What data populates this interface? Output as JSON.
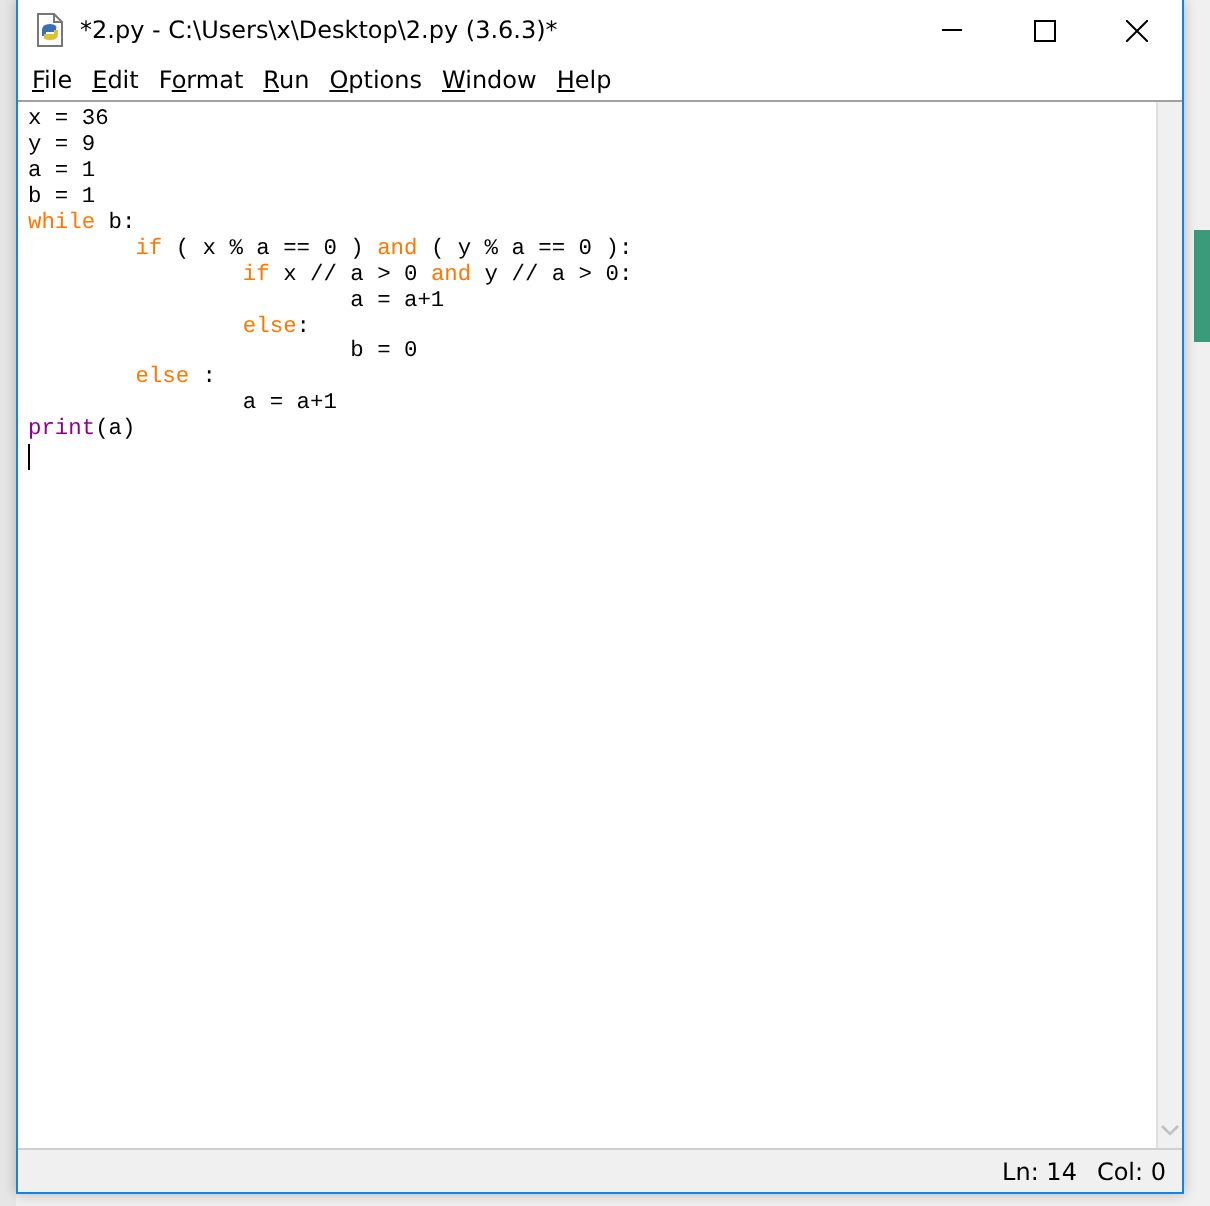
{
  "window": {
    "title": "*2.py - C:\\Users\\x\\Desktop\\2.py (3.6.3)*"
  },
  "menu": [
    {
      "key": "F",
      "after": "ile"
    },
    {
      "key": "E",
      "after": "dit"
    },
    {
      "before": "F",
      "key": "o",
      "after": "rmat"
    },
    {
      "key": "R",
      "after": "un"
    },
    {
      "key": "O",
      "after": "ptions"
    },
    {
      "key": "W",
      "after": "indow"
    },
    {
      "key": "H",
      "after": "elp"
    }
  ],
  "editor": {
    "lines": [
      {
        "tokens": [
          {
            "text": "x = 36",
            "kind": "plain"
          }
        ]
      },
      {
        "tokens": [
          {
            "text": "y = 9",
            "kind": "plain"
          }
        ]
      },
      {
        "tokens": [
          {
            "text": "a = 1",
            "kind": "plain"
          }
        ]
      },
      {
        "tokens": [
          {
            "text": "b = 1",
            "kind": "plain"
          }
        ]
      },
      {
        "tokens": [
          {
            "text": "while",
            "kind": "keyword"
          },
          {
            "text": " b:",
            "kind": "plain"
          }
        ]
      },
      {
        "tokens": [
          {
            "text": "\tif",
            "kind": "keyword"
          },
          {
            "text": " ( x % a == 0 ) ",
            "kind": "plain"
          },
          {
            "text": "and",
            "kind": "keyword"
          },
          {
            "text": " ( y % a == 0 ):",
            "kind": "plain"
          }
        ]
      },
      {
        "tokens": [
          {
            "text": "\t\tif",
            "kind": "keyword"
          },
          {
            "text": " x // a > 0 ",
            "kind": "plain"
          },
          {
            "text": "and",
            "kind": "keyword"
          },
          {
            "text": " y // a > 0:",
            "kind": "plain"
          }
        ]
      },
      {
        "tokens": [
          {
            "text": "\t\t\ta = a+1",
            "kind": "plain"
          }
        ]
      },
      {
        "tokens": [
          {
            "text": "\t\telse",
            "kind": "keyword"
          },
          {
            "text": ":",
            "kind": "plain"
          }
        ]
      },
      {
        "tokens": [
          {
            "text": "\t\t\tb = 0",
            "kind": "plain"
          }
        ]
      },
      {
        "tokens": [
          {
            "text": "\telse",
            "kind": "keyword"
          },
          {
            "text": " :",
            "kind": "plain"
          }
        ]
      },
      {
        "tokens": [
          {
            "text": "\t\ta = a+1",
            "kind": "plain"
          }
        ]
      },
      {
        "tokens": [
          {
            "text": "print",
            "kind": "builtin"
          },
          {
            "text": "(a)",
            "kind": "plain"
          }
        ]
      }
    ],
    "caret_visible": true
  },
  "status_bar": {
    "line": "Ln: 14",
    "column": "Col: 0"
  }
}
